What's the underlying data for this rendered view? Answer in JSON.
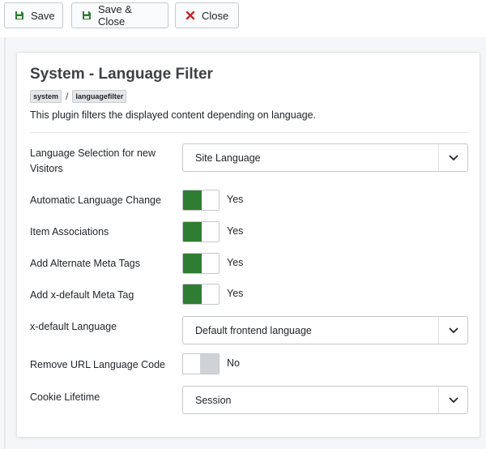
{
  "toolbar": {
    "save_label": "Save",
    "save_close_label": "Save & Close",
    "close_label": "Close"
  },
  "colors": {
    "accent_green": "#2f7d32",
    "close_red": "#c52827"
  },
  "plugin": {
    "title": "System - Language Filter",
    "breadcrumb": [
      "system",
      "languagefilter"
    ],
    "description": "This plugin filters the displayed content depending on language."
  },
  "fields": {
    "language_selection": {
      "label_line1": "Language Selection for new",
      "label_line2": "Visitors",
      "value": "Site Language"
    },
    "auto_language_change": {
      "label": "Automatic Language Change",
      "value": "Yes",
      "on": true
    },
    "item_associations": {
      "label": "Item Associations",
      "value": "Yes",
      "on": true
    },
    "alternate_meta_tags": {
      "label": "Add Alternate Meta Tags",
      "value": "Yes",
      "on": true
    },
    "xdefault_meta_tag": {
      "label": "Add x-default Meta Tag",
      "value": "Yes",
      "on": true
    },
    "xdefault_language": {
      "label": "x-default Language",
      "value": "Default frontend language"
    },
    "remove_url_code": {
      "label": "Remove URL Language Code",
      "value": "No",
      "on": false
    },
    "cookie_lifetime": {
      "label": "Cookie Lifetime",
      "value": "Session"
    }
  }
}
